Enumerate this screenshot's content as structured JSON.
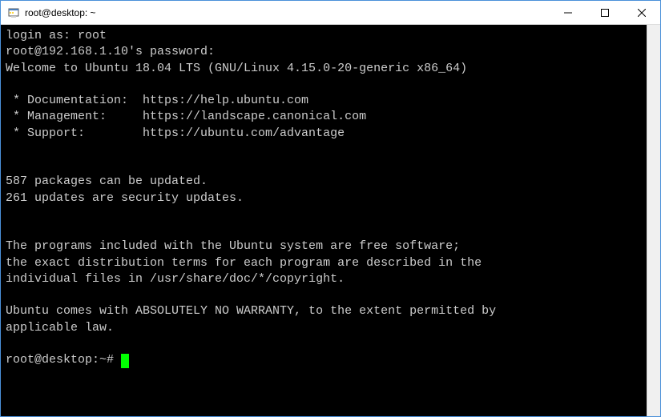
{
  "window": {
    "title": "root@desktop: ~"
  },
  "terminal": {
    "lines": [
      "login as: root",
      "root@192.168.1.10's password:",
      "Welcome to Ubuntu 18.04 LTS (GNU/Linux 4.15.0-20-generic x86_64)",
      "",
      " * Documentation:  https://help.ubuntu.com",
      " * Management:     https://landscape.canonical.com",
      " * Support:        https://ubuntu.com/advantage",
      "",
      "",
      "587 packages can be updated.",
      "261 updates are security updates.",
      "",
      "",
      "The programs included with the Ubuntu system are free software;",
      "the exact distribution terms for each program are described in the",
      "individual files in /usr/share/doc/*/copyright.",
      "",
      "Ubuntu comes with ABSOLUTELY NO WARRANTY, to the extent permitted by",
      "applicable law.",
      ""
    ],
    "prompt": "root@desktop:~# "
  }
}
